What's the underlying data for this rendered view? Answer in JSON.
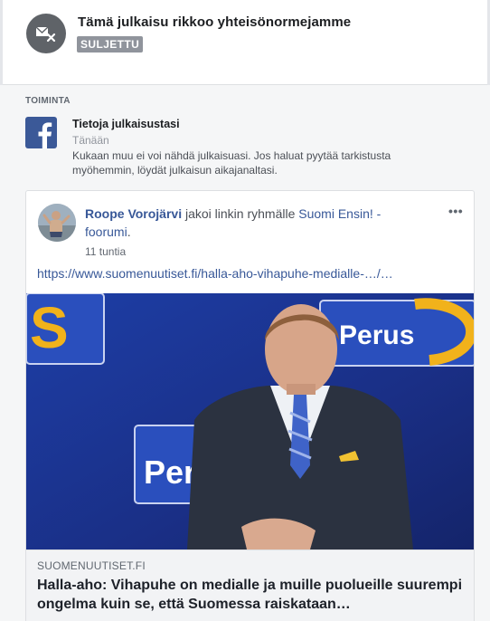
{
  "violation": {
    "title": "Tämä julkaisu rikkoo yhteisönormejamme",
    "status": "SULJETTU",
    "icon": "blocked-message-icon"
  },
  "activity": {
    "section_label": "TOIMINTA",
    "title": "Tietoja julkaisustasi",
    "date": "Tänään",
    "body": "Kukaan muu ei voi nähdä julkaisuasi. Jos haluat pyytää tarkistusta myöhemmin, löydät julkaisun aikajanaltasi.",
    "icon": "facebook-logo-icon"
  },
  "post": {
    "author": "Roope Vorojärvi",
    "action": " jakoi linkin ryhmälle ",
    "group": "Suomi Ensin! - foorumi",
    "suffix": ".",
    "time": "11 tuntia",
    "more_label": "•••",
    "link_url": "https://www.suomenuutiset.fi/halla-aho-vihapuhe-medialle-…/…",
    "preview": {
      "domain": "SUOMENUUTISET.FI",
      "title": "Halla-aho: Vihapuhe on medialle ja muille puolueille suurempi ongelma kuin se, että Suomessa raiskataan…",
      "sign_text_left": "S",
      "sign_text_right": "Perus",
      "sign_text_bottom": "Per"
    }
  },
  "colors": {
    "link_blue": "#385898",
    "facebook_blue": "#3b5998",
    "badge_gray": "#90949c",
    "backdrop_blue": "#1f3fa0",
    "sign_gold": "#f1b21b"
  }
}
